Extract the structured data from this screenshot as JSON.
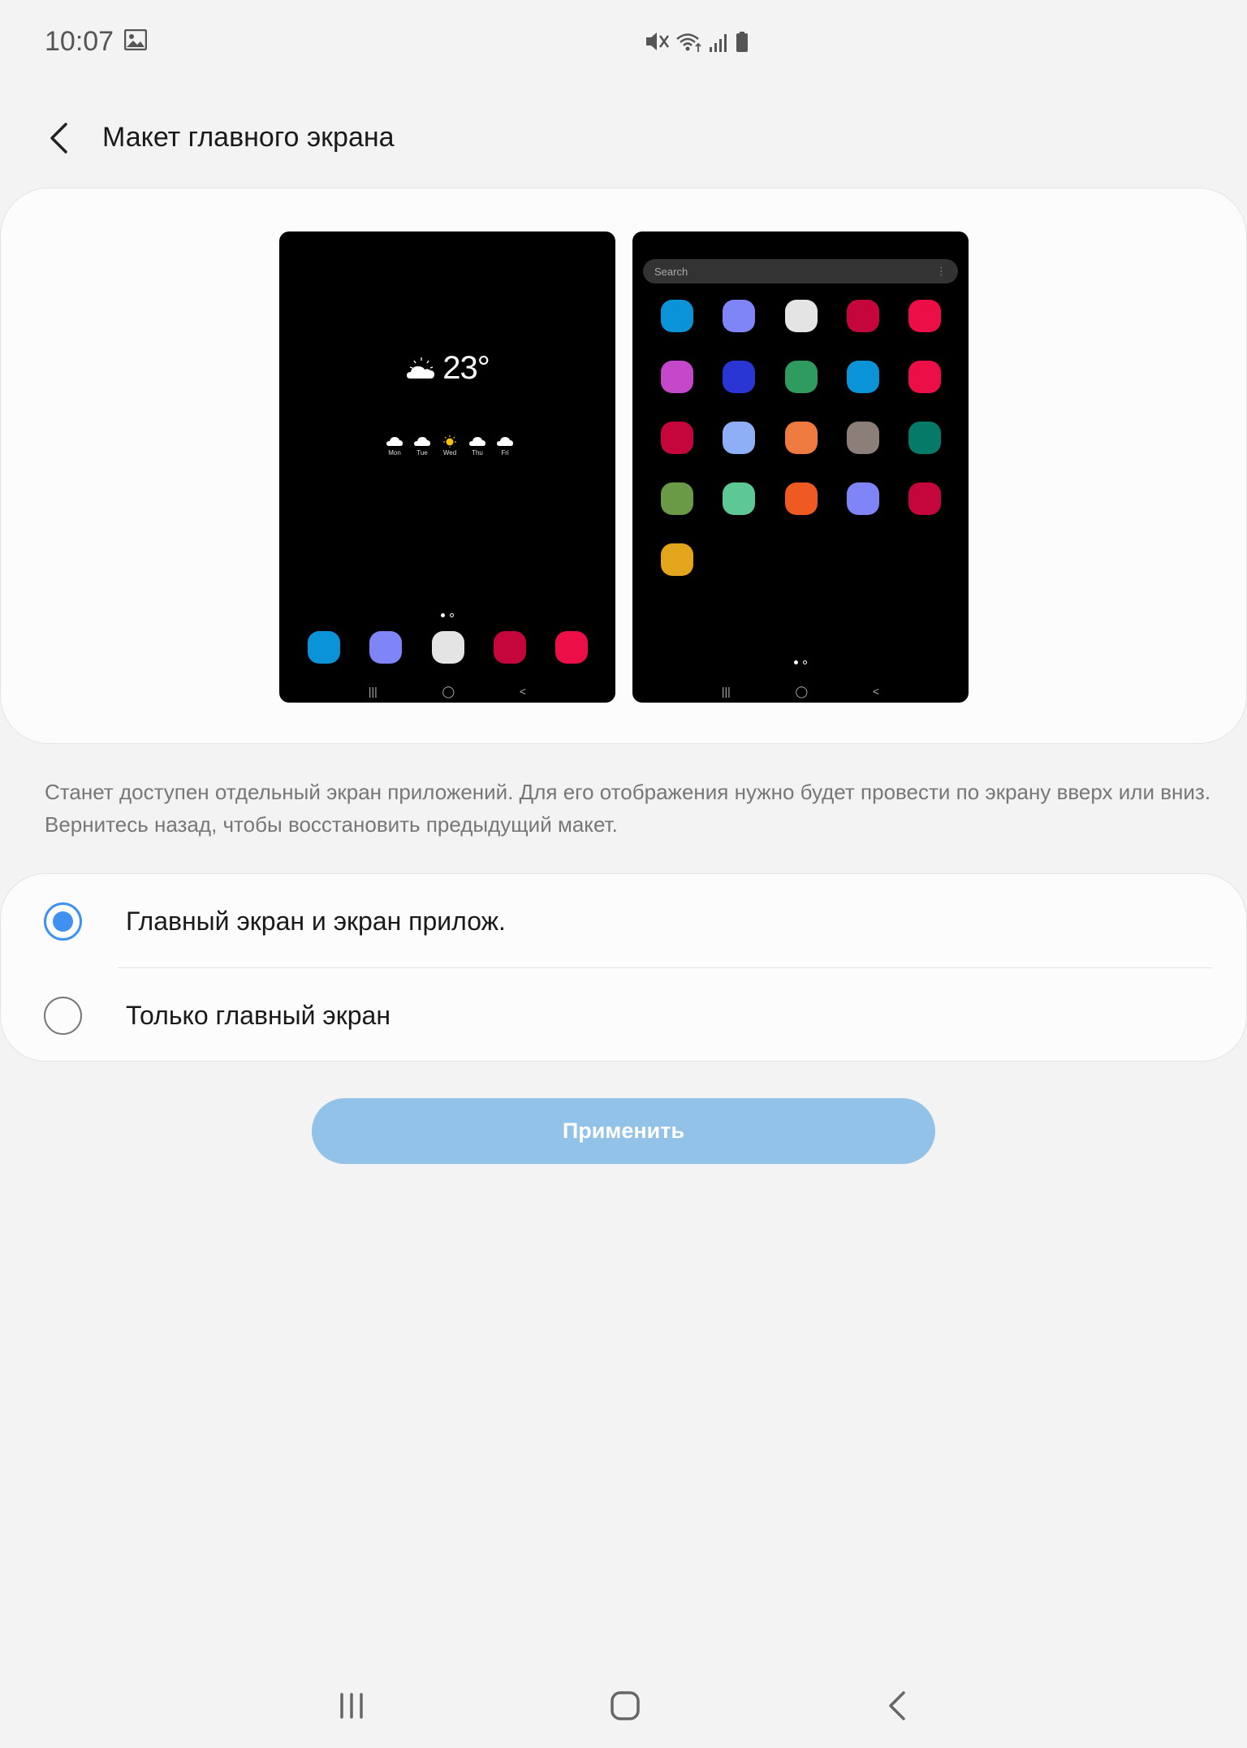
{
  "status_bar": {
    "time": "10:07",
    "icons": [
      "gallery-icon",
      "mute-icon",
      "wifi-icon",
      "signal-icon",
      "battery-icon"
    ]
  },
  "header": {
    "back_icon": "chevron-left-icon",
    "title": "Макет главного экрана"
  },
  "preview": {
    "home_screen": {
      "weather": {
        "temperature": "23°",
        "condition_icon": "partly-cloudy-icon",
        "forecast": [
          {
            "day": "Mon",
            "icon": "cloud-icon"
          },
          {
            "day": "Tue",
            "icon": "cloud-icon"
          },
          {
            "day": "Wed",
            "icon": "sun-icon"
          },
          {
            "day": "Thu",
            "icon": "cloud-icon"
          },
          {
            "day": "Fri",
            "icon": "cloud-icon"
          }
        ]
      },
      "dock_colors": [
        "#0b93d8",
        "#7f85f6",
        "#e4e4e4",
        "#c4063d",
        "#ec0e47"
      ]
    },
    "apps_screen": {
      "search_placeholder": "Search",
      "app_colors": [
        "#0b93d8",
        "#7f85f6",
        "#e4e4e4",
        "#c4063d",
        "#ec0e47",
        "#c448c9",
        "#2a36d4",
        "#2f9b5e",
        "#0b93d8",
        "#ec0e47",
        "#c4063d",
        "#8eaef6",
        "#ef7a3f",
        "#8c7f7a",
        "#057a68",
        "#6a9a45",
        "#5ec895",
        "#ee5a22",
        "#7f85f6",
        "#c4063d",
        "#e3a51c"
      ]
    }
  },
  "description": "Станет доступен отдельный экран приложений. Для его отображения нужно будет провести по экрану вверх или вниз. Вернитесь назад, чтобы восстановить предыдущий макет.",
  "options": [
    {
      "label": "Главный экран и экран прилож.",
      "selected": true
    },
    {
      "label": "Только главный экран",
      "selected": false
    }
  ],
  "apply_button": {
    "label": "Применить",
    "enabled": false
  },
  "colors": {
    "accent": "#3e91f0",
    "button_disabled": "#93c2e8",
    "background": "#f3f3f3"
  },
  "navigation_bar": [
    "recent-apps-icon",
    "home-icon",
    "back-icon"
  ]
}
